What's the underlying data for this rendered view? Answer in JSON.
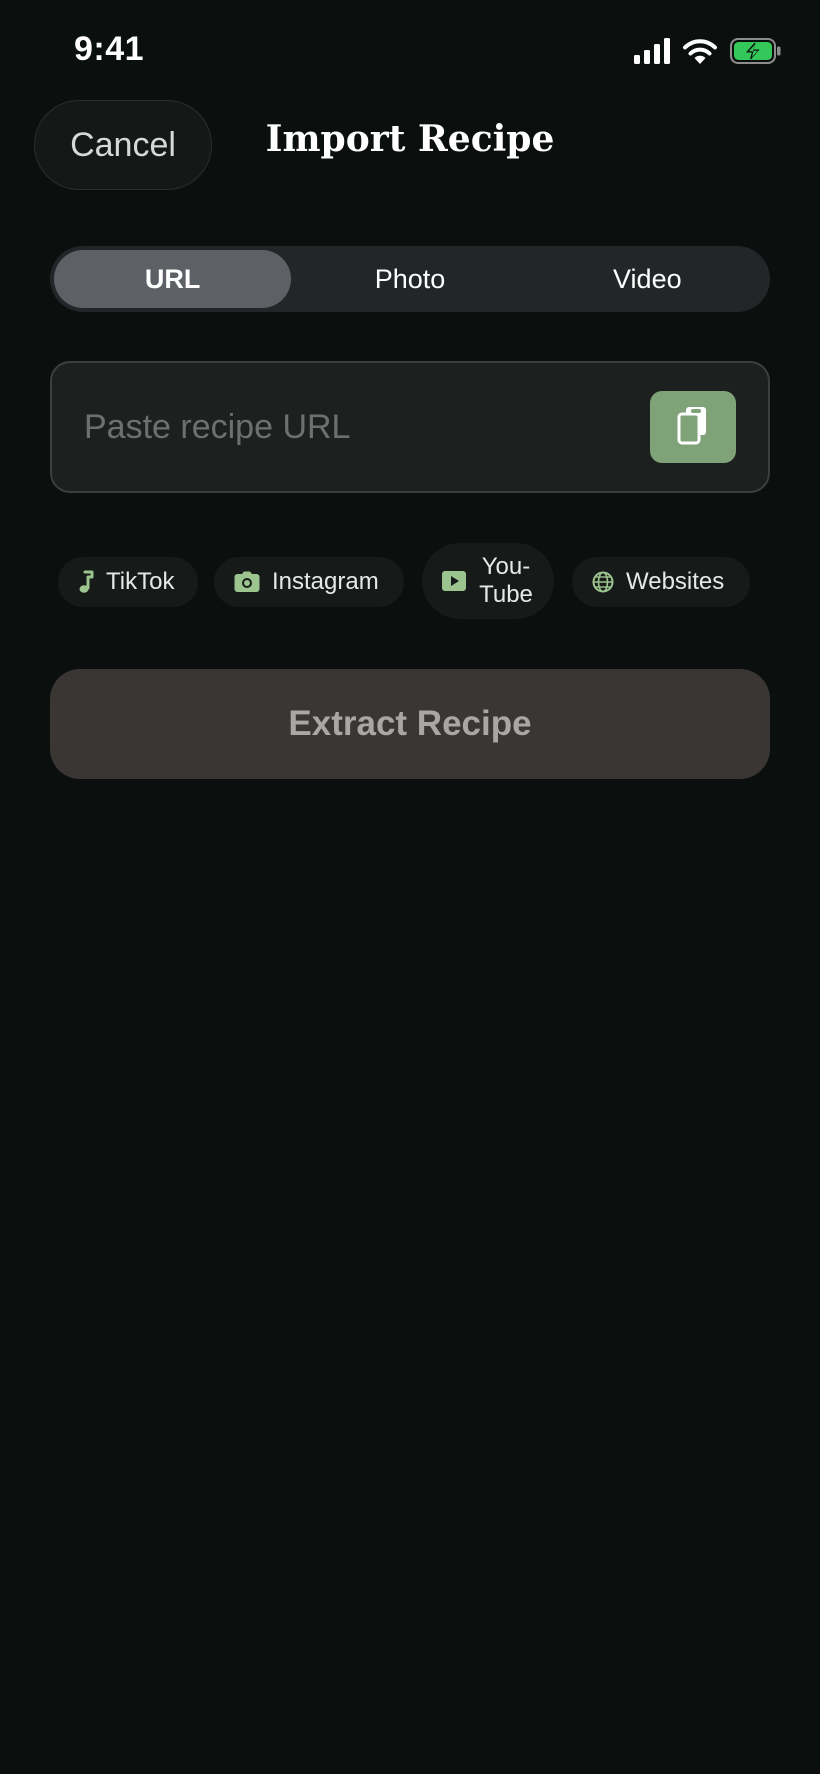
{
  "status_bar": {
    "time": "9:41",
    "icons": [
      "cellular-signal-icon",
      "wifi-icon",
      "battery-charging-icon"
    ]
  },
  "header": {
    "cancel_label": "Cancel",
    "title": "Import Recipe"
  },
  "segmented_control": {
    "segments": [
      {
        "label": "URL",
        "selected": true
      },
      {
        "label": "Photo",
        "selected": false
      },
      {
        "label": "Video",
        "selected": false
      }
    ]
  },
  "url_input": {
    "placeholder": "Paste recipe URL",
    "value": "",
    "paste_icon": "clipboard-paste-icon"
  },
  "sources": [
    {
      "label": "TikTok",
      "icon": "music-note-icon"
    },
    {
      "label": "Instagram",
      "icon": "camera-icon"
    },
    {
      "label": "You-Tube",
      "icon": "play-icon"
    },
    {
      "label": "Websites",
      "icon": "globe-icon"
    }
  ],
  "extract_button": {
    "label": "Extract Recipe",
    "enabled": false
  },
  "colors": {
    "background": "#0b0f0d",
    "accent": "#7fa278",
    "icon_accent": "#9cc48e",
    "segment_active": "#5d6064",
    "battery_fill": "#34c759",
    "extract_disabled_bg": "#393634"
  }
}
